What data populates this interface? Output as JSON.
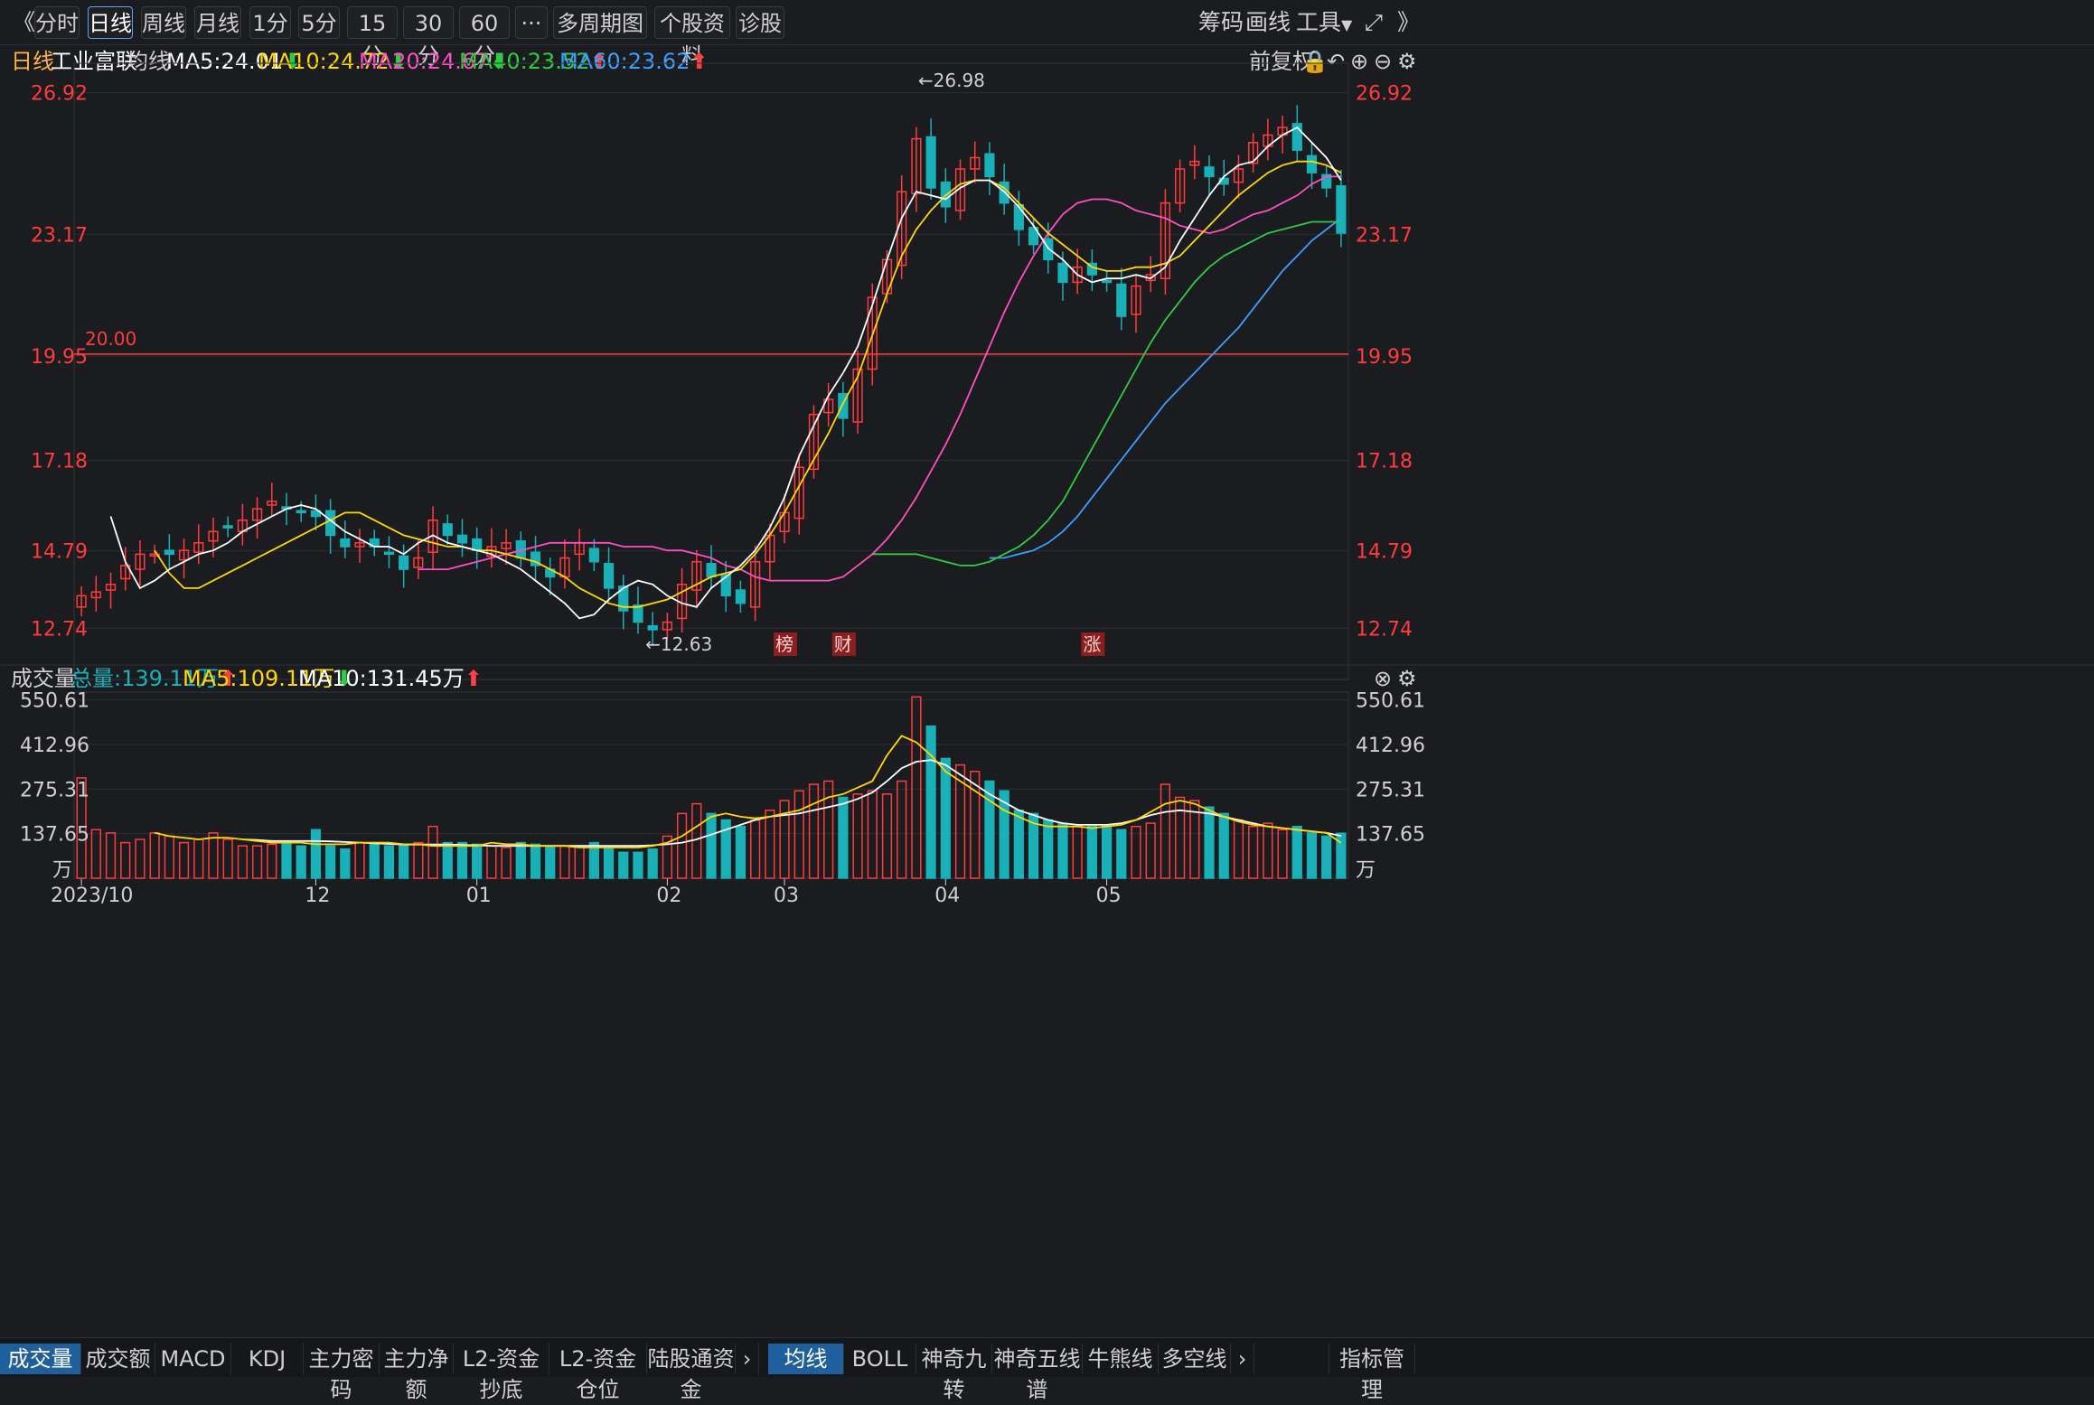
{
  "toolbar": {
    "collapse": "《",
    "periods": [
      "分时",
      "日线",
      "周线",
      "月线",
      "1分",
      "5分",
      "15分",
      "30分",
      "60分"
    ],
    "active_period": "日线",
    "more": "···",
    "multi": "多周期图",
    "profile": "个股资料",
    "diagnose": "诊股",
    "right": [
      "筹码",
      "画线",
      "工具"
    ],
    "expand": "》"
  },
  "info": {
    "period": "日线",
    "stock": "工业富联",
    "avg_label": "均线",
    "ma5": "MA5:24.01",
    "ma10": "MA10:24.72",
    "ma20": "MA20:24.67",
    "ma40": "MA40:23.52",
    "ma60": "MA60:23.62",
    "adjust": "前复权"
  },
  "colors": {
    "ma5": "#ffffff",
    "ma10": "#ffd700",
    "ma20": "#ff4fc3",
    "ma40": "#2ecc40",
    "ma60": "#3aa0ff",
    "up": "#ff3b3b",
    "down": "#19b0b8",
    "price_label": "#ff3b3b"
  },
  "price_axis": {
    "ticks": [
      "26.92",
      "23.17",
      "19.95",
      "17.18",
      "14.79",
      "12.74"
    ],
    "values": [
      26.92,
      23.17,
      19.95,
      17.18,
      14.79,
      12.74
    ],
    "min": 12.1,
    "max": 27.7
  },
  "annotations": {
    "high": "←26.98",
    "low": "←12.63",
    "level": "20.00",
    "level_value": 20.0,
    "events": [
      "榜",
      "财",
      "涨"
    ],
    "event_index": [
      48,
      52,
      69
    ]
  },
  "volume": {
    "title": "成交量",
    "total": "总量:139.11万",
    "ma5": "MA5:109.11万",
    "ma10": "MA10:131.45万",
    "ticks": [
      "550.61",
      "412.96",
      "275.31",
      "137.65"
    ],
    "values": [
      550.61,
      412.96,
      275.31,
      137.65
    ],
    "unit": "万",
    "max": 575
  },
  "x_axis": {
    "labels": [
      "2023/10",
      "12",
      "01",
      "02",
      "03",
      "04",
      "05"
    ],
    "index": [
      0,
      16,
      27,
      40,
      48,
      59,
      70
    ]
  },
  "chart_data": {
    "type": "candlestick",
    "closes": [
      13.6,
      13.7,
      13.9,
      14.4,
      14.7,
      14.7,
      14.7,
      14.8,
      15.0,
      15.3,
      15.4,
      15.6,
      15.9,
      16.1,
      15.9,
      15.8,
      15.7,
      15.2,
      14.9,
      15.0,
      14.9,
      14.7,
      14.3,
      14.6,
      15.6,
      15.2,
      15.0,
      14.8,
      14.9,
      15.0,
      14.6,
      14.4,
      14.1,
      14.6,
      15.0,
      14.5,
      13.8,
      13.2,
      12.9,
      12.7,
      12.9,
      13.9,
      14.5,
      14.1,
      13.6,
      13.4,
      14.5,
      15.2,
      15.8,
      17.0,
      18.4,
      18.8,
      18.3,
      19.6,
      21.5,
      22.5,
      24.3,
      25.7,
      24.4,
      23.9,
      24.9,
      25.2,
      24.7,
      24.0,
      23.3,
      22.9,
      22.5,
      21.9,
      22.3,
      22.1,
      21.9,
      21.0,
      21.8,
      22.1,
      24.0,
      24.9,
      25.1,
      24.7,
      24.5,
      24.9,
      25.6,
      25.8,
      26.0,
      25.4,
      24.8,
      24.4,
      23.2
    ],
    "ma5": [
      15.7,
      14.5,
      13.8,
      14.0,
      14.3,
      14.5,
      14.7,
      14.8,
      15.0,
      15.3,
      15.5,
      15.7,
      15.9,
      16.0,
      15.9,
      15.6,
      15.3,
      15.1,
      14.9,
      14.9,
      14.7,
      15.0,
      15.2,
      15.0,
      14.9,
      14.8,
      14.7,
      14.5,
      14.3,
      14.0,
      13.7,
      13.4,
      13.0,
      13.1,
      13.5,
      13.8,
      14.0,
      13.9,
      13.6,
      13.4,
      13.3,
      13.8,
      14.1,
      14.4,
      14.8,
      15.4,
      16.2,
      17.3,
      18.1,
      18.9,
      19.5,
      20.2,
      21.3,
      22.5,
      23.6,
      24.3,
      24.2,
      24.1,
      24.4,
      24.6,
      24.6,
      24.3,
      23.9,
      23.4,
      22.8,
      22.5,
      22.1,
      21.9,
      22.0,
      22.0,
      22.1,
      22.0,
      22.3,
      23.0,
      23.6,
      24.2,
      24.7,
      25.0,
      25.1,
      25.5,
      25.8,
      26.0,
      25.6,
      25.2,
      24.6
    ],
    "ma10": [
      14.8,
      14.2,
      13.8,
      13.8,
      14.0,
      14.2,
      14.4,
      14.6,
      14.8,
      15.0,
      15.2,
      15.4,
      15.6,
      15.8,
      15.8,
      15.6,
      15.4,
      15.2,
      15.1,
      15.0,
      14.9,
      14.9,
      14.8,
      14.8,
      14.7,
      14.6,
      14.5,
      14.3,
      14.1,
      13.8,
      13.6,
      13.4,
      13.3,
      13.3,
      13.4,
      13.5,
      13.7,
      13.9,
      14.1,
      14.2,
      14.3,
      14.7,
      15.2,
      15.8,
      16.5,
      17.2,
      17.9,
      18.7,
      19.4,
      20.5,
      21.6,
      22.6,
      23.3,
      23.8,
      24.2,
      24.5,
      24.6,
      24.6,
      24.4,
      24.0,
      23.6,
      23.2,
      22.9,
      22.6,
      22.3,
      22.2,
      22.2,
      22.3,
      22.3,
      22.4,
      22.6,
      23.0,
      23.4,
      23.8,
      24.2,
      24.5,
      24.8,
      25.0,
      25.1,
      25.1,
      25.0,
      24.8
    ],
    "ma20": [
      14.3,
      14.3,
      14.3,
      14.4,
      14.5,
      14.6,
      14.7,
      14.8,
      14.9,
      15.0,
      15.0,
      15.0,
      15.0,
      15.0,
      14.9,
      14.9,
      14.9,
      14.8,
      14.8,
      14.7,
      14.6,
      14.4,
      14.3,
      14.1,
      14.0,
      14.0,
      14.0,
      14.0,
      14.0,
      14.1,
      14.4,
      14.7,
      15.1,
      15.6,
      16.2,
      16.9,
      17.6,
      18.4,
      19.3,
      20.2,
      21.1,
      21.9,
      22.6,
      23.2,
      23.7,
      24.0,
      24.1,
      24.1,
      24.0,
      23.8,
      23.7,
      23.6,
      23.4,
      23.3,
      23.2,
      23.3,
      23.5,
      23.7,
      23.8,
      24.0,
      24.2,
      24.5,
      24.7,
      24.7
    ],
    "ma40": [
      14.7,
      14.7,
      14.7,
      14.7,
      14.6,
      14.5,
      14.4,
      14.4,
      14.5,
      14.7,
      14.9,
      15.2,
      15.6,
      16.1,
      16.8,
      17.5,
      18.2,
      18.9,
      19.6,
      20.3,
      20.9,
      21.4,
      21.9,
      22.3,
      22.6,
      22.8,
      23.0,
      23.2,
      23.3,
      23.4,
      23.5,
      23.5,
      23.5
    ],
    "ma60": [
      14.6,
      14.6,
      14.7,
      14.8,
      15.0,
      15.3,
      15.7,
      16.2,
      16.7,
      17.2,
      17.7,
      18.2,
      18.7,
      19.1,
      19.5,
      19.9,
      20.3,
      20.7,
      21.2,
      21.7,
      22.2,
      22.6,
      23.0,
      23.3,
      23.6
    ],
    "volumes": [
      310,
      150,
      140,
      110,
      120,
      140,
      130,
      110,
      120,
      140,
      120,
      100,
      100,
      105,
      110,
      100,
      150,
      100,
      90,
      110,
      110,
      100,
      100,
      110,
      160,
      110,
      110,
      105,
      100,
      95,
      110,
      105,
      100,
      100,
      100,
      110,
      95,
      80,
      80,
      90,
      130,
      200,
      230,
      200,
      180,
      160,
      180,
      210,
      240,
      270,
      290,
      300,
      250,
      260,
      270,
      260,
      300,
      560,
      470,
      370,
      350,
      330,
      300,
      270,
      210,
      200,
      180,
      170,
      160,
      160,
      160,
      150,
      160,
      170,
      290,
      250,
      240,
      220,
      200,
      180,
      160,
      170,
      150,
      160,
      140,
      130,
      139
    ],
    "vma5": [
      140,
      130,
      125,
      120,
      125,
      125,
      120,
      115,
      110,
      110,
      110,
      105,
      105,
      105,
      110,
      110,
      110,
      105,
      105,
      100,
      100,
      100,
      100,
      110,
      105,
      105,
      100,
      100,
      100,
      95,
      95,
      95,
      95,
      95,
      100,
      110,
      130,
      160,
      190,
      200,
      190,
      185,
      190,
      200,
      210,
      230,
      250,
      260,
      280,
      300,
      380,
      440,
      420,
      380,
      330,
      300,
      270,
      240,
      210,
      190,
      170,
      160,
      160,
      160,
      155,
      160,
      165,
      180,
      205,
      230,
      240,
      230,
      210,
      190,
      175,
      165,
      160,
      155,
      150,
      145,
      140,
      109
    ],
    "vma10": [
      120,
      118,
      115,
      115,
      115,
      115,
      114,
      112,
      110,
      108,
      106,
      104,
      104,
      104,
      104,
      103,
      102,
      100,
      100,
      100,
      100,
      100,
      100,
      100,
      100,
      100,
      100,
      100,
      102,
      105,
      110,
      120,
      135,
      150,
      165,
      180,
      190,
      195,
      200,
      210,
      220,
      230,
      245,
      265,
      300,
      340,
      360,
      365,
      350,
      320,
      290,
      260,
      235,
      210,
      195,
      180,
      170,
      165,
      165,
      165,
      170,
      180,
      195,
      205,
      210,
      205,
      200,
      190,
      180,
      170,
      160,
      155,
      150,
      145,
      140,
      131
    ]
  }
}
